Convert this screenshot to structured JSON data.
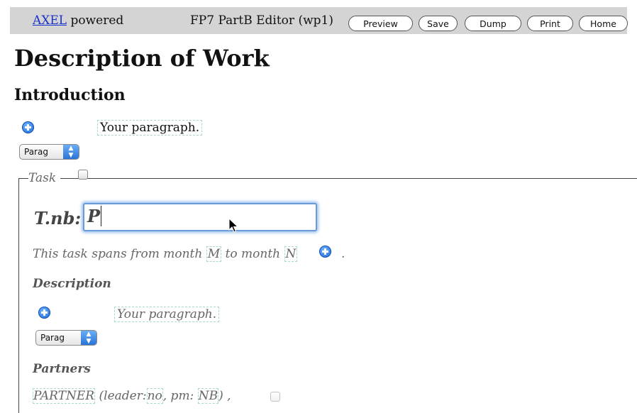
{
  "toolbar": {
    "brand_link": "AXEL",
    "brand_suffix": "powered",
    "editor_title": "FP7 PartB Editor (wp1)",
    "buttons": {
      "preview": "Preview",
      "save": "Save",
      "dump": "Dump",
      "print": "Print",
      "home": "Home"
    }
  },
  "document": {
    "title": "Description of Work",
    "introduction": {
      "heading": "Introduction",
      "paragraph_placeholder": "Your paragraph.",
      "type_select": "Parag"
    },
    "task": {
      "legend": "Task",
      "nb_label": "T.nb:",
      "nb_value": "P",
      "span_prefix": "This task spans from month",
      "start_month": "M",
      "span_mid": "to month",
      "end_month": "N",
      "span_end": ".",
      "description_heading": "Description",
      "description_placeholder": "Your paragraph.",
      "description_select": "Parag",
      "partners_heading": "Partners",
      "partner_name": "PARTNER",
      "leader_prefix": "(leader:",
      "leader_value": "no",
      "pm_prefix": ", pm:",
      "pm_value": "NB",
      "partner_suffix": ") ,"
    }
  }
}
